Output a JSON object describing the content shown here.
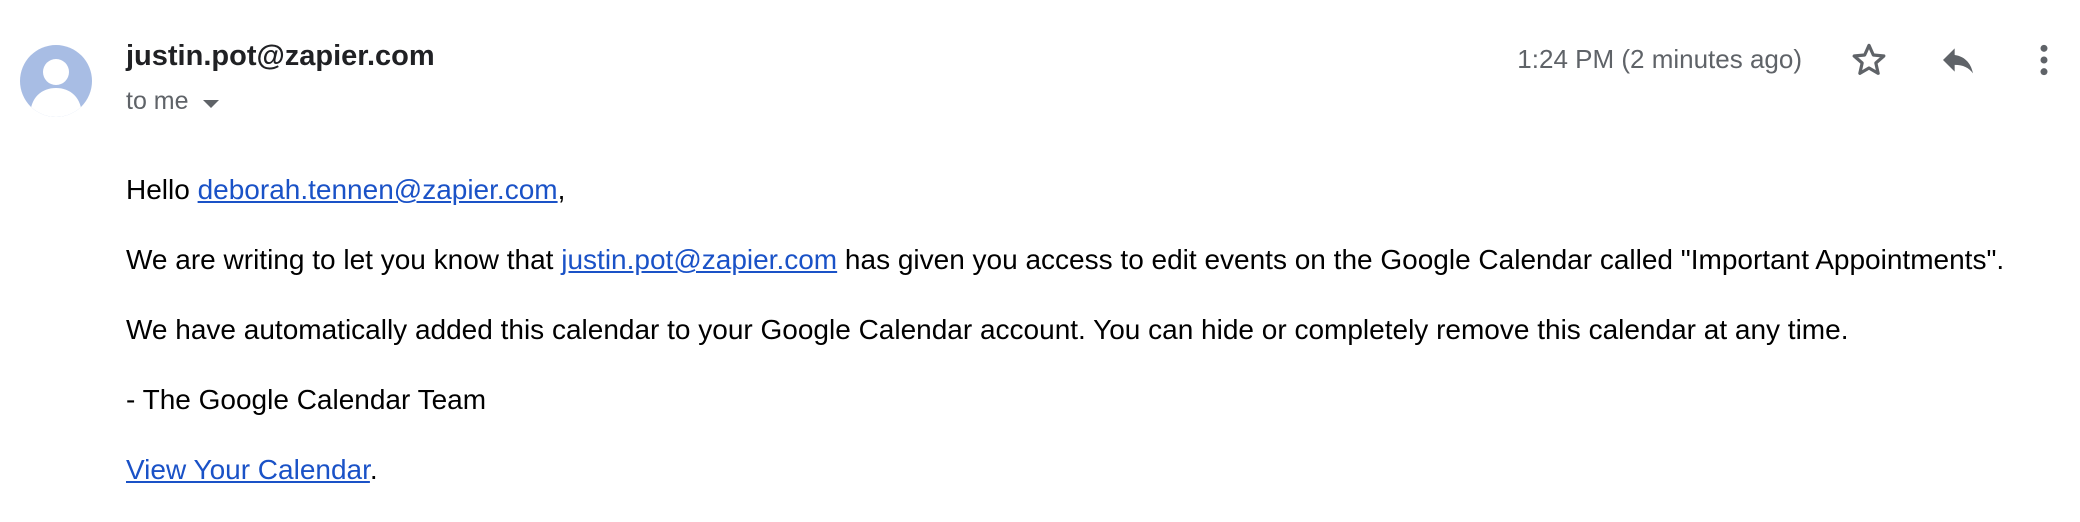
{
  "header": {
    "sender": "justin.pot@zapier.com",
    "recipient_label": "to me",
    "timestamp": "1:24 PM (2 minutes ago)"
  },
  "actions": {
    "star_icon": "star-outline-icon",
    "reply_icon": "reply-icon",
    "more_icon": "more-vert-icon"
  },
  "body": {
    "greeting_prefix": "Hello ",
    "greeting_link": "deborah.tennen@zapier.com",
    "greeting_suffix": ",",
    "line1_prefix": "We are writing to let you know that ",
    "line1_link": "justin.pot@zapier.com",
    "line1_suffix": " has given you access to edit events on the Google Calendar called \"Important Appointments\".",
    "line2": "We have automatically added this calendar to your Google Calendar account. You can hide or completely remove this calendar at any time.",
    "signature": "- The Google Calendar Team",
    "view_link": "View Your Calendar",
    "view_suffix": "."
  },
  "colors": {
    "link": "#1a52c7",
    "avatar_bg": "#a8bde4",
    "avatar_fg": "#ffffff",
    "secondary_text": "#5f6368"
  }
}
